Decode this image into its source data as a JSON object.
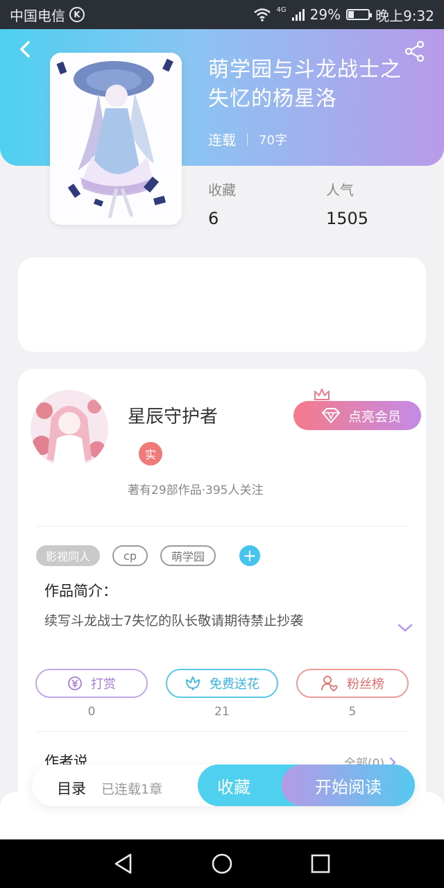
{
  "status_bar": {
    "carrier": "中国电信",
    "carrier_icon": "K",
    "network": "4G",
    "battery": "29%",
    "battery_level": 0.29,
    "time": "晚上9:32"
  },
  "book": {
    "title": "萌学园与斗龙战士之失忆的杨星洛",
    "status": "连载",
    "word_count": "70字",
    "stats": [
      {
        "label": "收藏",
        "value": "6"
      },
      {
        "label": "人气",
        "value": "1505"
      }
    ]
  },
  "author": {
    "name": "星辰守护者",
    "verified_badge": "实",
    "summary": "著有29部作品·395人关注",
    "vip_label": "点亮会员"
  },
  "tags": [
    "影视同人",
    "cp",
    "萌学园"
  ],
  "add_tag_icon": "+",
  "intro": {
    "label": "作品简介：",
    "text": "续写斗龙战士7失忆的队长敬请期待禁止抄袭"
  },
  "actions": [
    {
      "icon": "yen-icon",
      "label": "打赏",
      "count": "0"
    },
    {
      "icon": "flower-icon",
      "label": "免费送花",
      "count": "21"
    },
    {
      "icon": "fans-icon",
      "label": "粉丝榜",
      "count": "5"
    }
  ],
  "author_says": {
    "label": "作者说",
    "all_link": "全部(0)"
  },
  "bottom_bar": {
    "toc_label": "目录",
    "toc_sub": "已连载1章",
    "collect_label": "收藏",
    "read_label": "开始阅读"
  },
  "colors": {
    "accent_blue": "#4fd0ef",
    "accent_purple": "#b89ae9",
    "accent_red": "#f07a7a"
  }
}
